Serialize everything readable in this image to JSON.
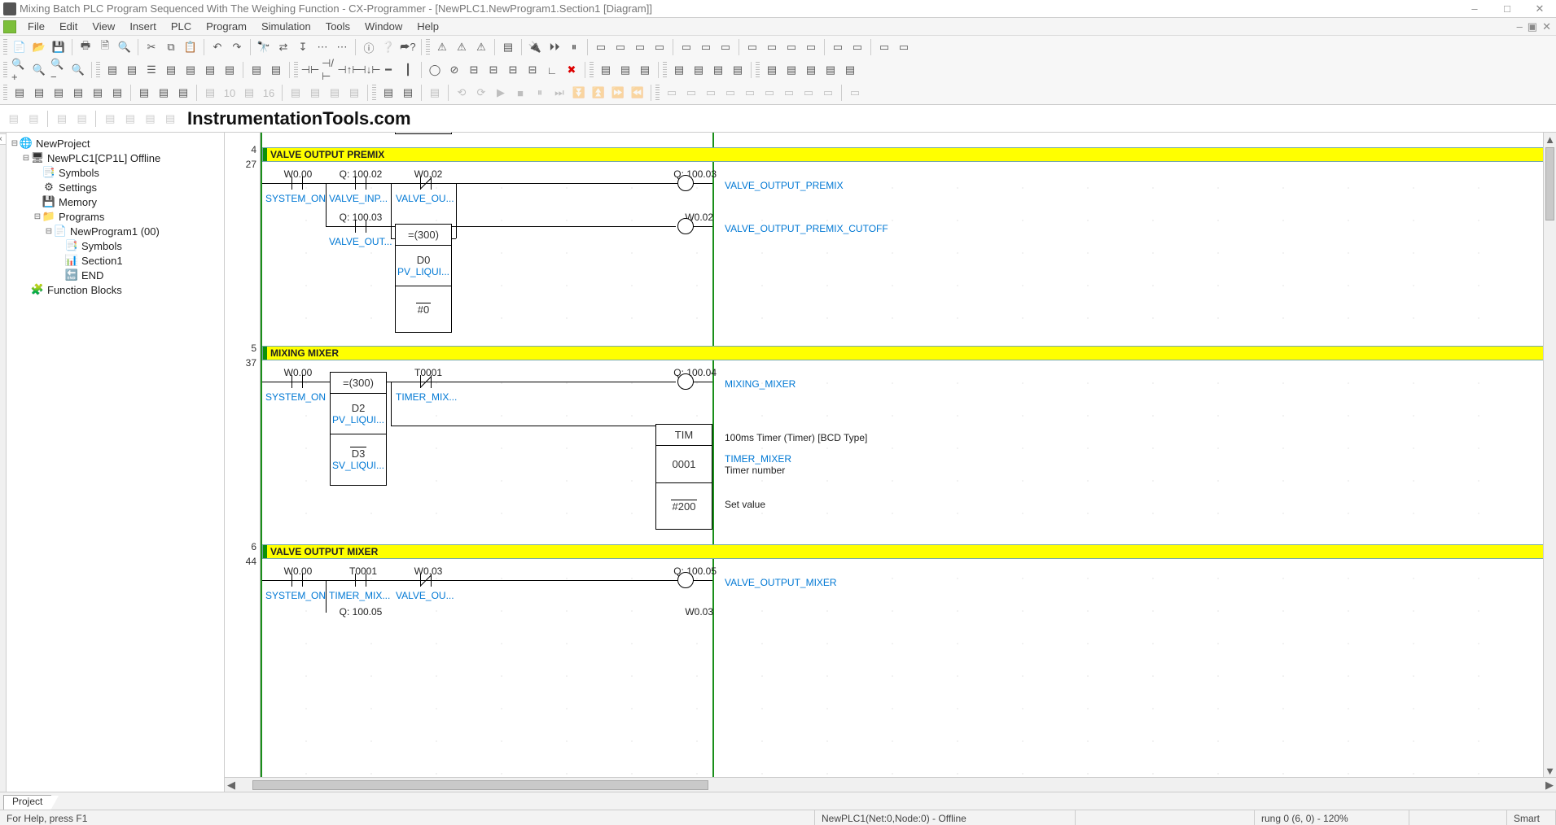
{
  "title": "Mixing Batch PLC Program Sequenced With The Weighing Function - CX-Programmer - [NewPLC1.NewProgram1.Section1 [Diagram]]",
  "menus": [
    "File",
    "Edit",
    "View",
    "Insert",
    "PLC",
    "Program",
    "Simulation",
    "Tools",
    "Window",
    "Help"
  ],
  "watermark": "InstrumentationTools.com",
  "tree": {
    "root": "NewProject",
    "plc": "NewPLC1[CP1L] Offline",
    "symbols": "Symbols",
    "settings": "Settings",
    "memory": "Memory",
    "programs": "Programs",
    "program": "NewProgram1 (00)",
    "program_symbols": "Symbols",
    "section": "Section1",
    "end": "END",
    "fblocks": "Function Blocks"
  },
  "project_tab": "Project",
  "gutter": {
    "r4a": "4",
    "r4b": "27",
    "r5a": "5",
    "r5b": "37",
    "r6a": "6",
    "r6b": "44"
  },
  "rung4": {
    "title": "VALVE OUTPUT PREMIX",
    "c1_addr": "W0.00",
    "c1_sym": "SYSTEM_ON",
    "c2_addr": "Q: 100.02",
    "c2_sym": "VALVE_INP...",
    "c3_addr": "W0.02",
    "c3_sym": "VALVE_OU...",
    "c4_addr": "Q: 100.03",
    "c4_sym": "VALVE_OUT...",
    "coil1_addr": "Q: 100.03",
    "coil1_sym": "VALVE_OUTPUT_PREMIX",
    "coil2_addr": "W0.02",
    "coil2_sym": "VALVE_OUTPUT_PREMIX_CUTOFF",
    "cmp_op": "=(300)",
    "cmp_d": "D0",
    "cmp_sym": "PV_LIQUI...",
    "cmp_k": "#0"
  },
  "rung5": {
    "title": "MIXING MIXER",
    "c1_addr": "W0.00",
    "c1_sym": "SYSTEM_ON",
    "c2_addr": "T0001",
    "c2_sym": "TIMER_MIX...",
    "cmp_op": "=(300)",
    "cmp_d1": "D2",
    "cmp_s1": "PV_LIQUI...",
    "cmp_d2": "D3",
    "cmp_s2": "SV_LIQUI...",
    "coil_addr": "Q: 100.04",
    "coil_sym": "MIXING_MIXER",
    "tim_name": "TIM",
    "tim_desc": "100ms Timer (Timer) [BCD Type]",
    "tim_n": "0001",
    "tim_n_sym": "TIMER_MIXER",
    "tim_n_cmt": "Timer number",
    "tim_sv": "#200",
    "tim_sv_cmt": "Set value"
  },
  "rung6": {
    "title": "VALVE OUTPUT MIXER",
    "c1_addr": "W0.00",
    "c1_sym": "SYSTEM_ON",
    "c2_addr": "T0001",
    "c2_sym": "TIMER_MIX...",
    "c3_addr": "W0.03",
    "c3_sym": "VALVE_OU...",
    "c4_addr": "Q: 100.05",
    "coil1_addr": "Q: 100.05",
    "coil1_sym": "VALVE_OUTPUT_MIXER",
    "coil2_addr": "W0.03"
  },
  "status": {
    "help": "For Help, press F1",
    "conn": "NewPLC1(Net:0,Node:0) - Offline",
    "pos": "rung 0 (6, 0)  - 120%",
    "smart": "Smart"
  }
}
